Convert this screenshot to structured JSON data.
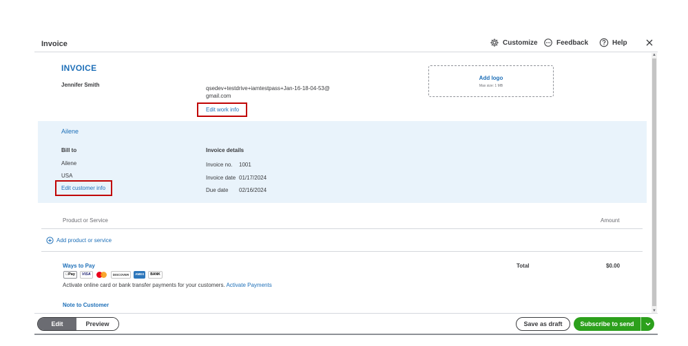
{
  "header": {
    "title": "Invoice",
    "customize_label": "Customize",
    "feedback_label": "Feedback",
    "help_label": "Help"
  },
  "invoice": {
    "heading": "INVOICE",
    "company_name": "Jennifer Smith",
    "email": "qsedev+testdrive+iamtestpass+Jan-16-18-04-53@gmail.com",
    "edit_work_label": "Edit work info",
    "logo": {
      "add_label": "Add logo",
      "max_size": "Max size: 1 MB"
    }
  },
  "customer": {
    "name": "Ailene",
    "bill_to_heading": "Bill to",
    "bill_to_lines": [
      "Ailene",
      "USA"
    ],
    "edit_customer_label": "Edit customer info"
  },
  "details": {
    "heading": "Invoice details",
    "rows": [
      {
        "label": "Invoice no.",
        "value": "1001"
      },
      {
        "label": "Invoice date",
        "value": "01/17/2024"
      },
      {
        "label": "Due date",
        "value": "02/16/2024"
      }
    ]
  },
  "line_items": {
    "product_header": "Product or Service",
    "amount_header": "Amount",
    "add_label": "Add product or service"
  },
  "payments": {
    "heading": "Ways to Pay",
    "icons": [
      "Pay",
      "VISA",
      "DISCOVER",
      "AMEX",
      "BANK"
    ],
    "activate_text": "Activate online card or bank transfer payments for your customers.",
    "activate_link": "Activate Payments"
  },
  "note": {
    "heading": "Note to Customer"
  },
  "totals": {
    "label": "Total",
    "value": "$0.00"
  },
  "footer": {
    "edit_label": "Edit",
    "preview_label": "Preview",
    "save_draft_label": "Save as draft",
    "subscribe_label": "Subscribe to send"
  },
  "colors": {
    "brand_blue": "#1d6fb8",
    "highlight_red": "#c00000",
    "send_green": "#2ca01c",
    "panel_bg": "#e9f3fb"
  }
}
